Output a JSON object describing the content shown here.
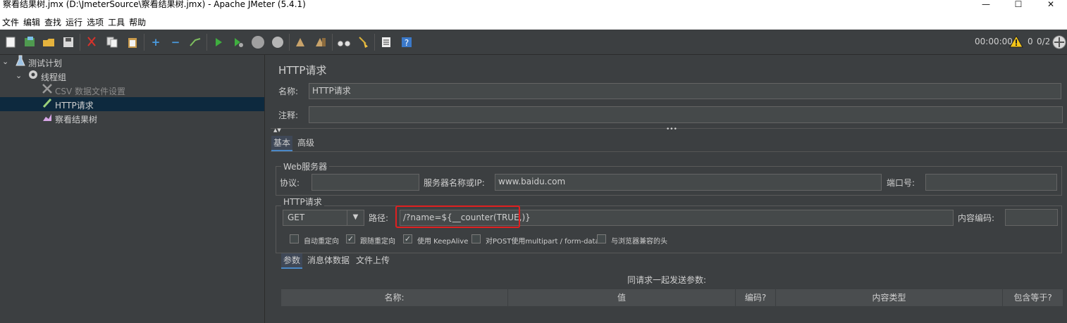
{
  "window": {
    "title": "察看结果树.jmx (D:\\JmeterSource\\察看结果树.jmx) - Apache JMeter (5.4.1)",
    "minimize": "—",
    "maximize": "☐",
    "close": "✕"
  },
  "menu": [
    "文件",
    "编辑",
    "查找",
    "运行",
    "选项",
    "工具",
    "帮助"
  ],
  "toolbar": {
    "timer": "00:00:00",
    "warnings": "0",
    "threads": "0/2"
  },
  "tree": {
    "items": [
      {
        "label": "测试计划"
      },
      {
        "label": "线程组"
      },
      {
        "label": "CSV 数据文件设置"
      },
      {
        "label": "HTTP请求"
      },
      {
        "label": "察看结果树"
      }
    ]
  },
  "panel": {
    "title": "HTTP请求",
    "name_label": "名称:",
    "name_value": "HTTP请求",
    "comment_label": "注释:",
    "comment_value": "",
    "tabs": [
      "基本",
      "高级"
    ],
    "web_server": {
      "legend": "Web服务器",
      "protocol_label": "协议:",
      "protocol_value": "",
      "server_label": "服务器名称或IP:",
      "server_value": "www.baidu.com",
      "port_label": "端口号:",
      "port_value": ""
    },
    "http_request": {
      "legend": "HTTP请求",
      "method": "GET",
      "path_label": "路径:",
      "path_value": "/?name=${__counter(TRUE,)}",
      "encoding_label": "内容编码:",
      "encoding_value": ""
    },
    "options": [
      {
        "label": "自动重定向",
        "checked": false
      },
      {
        "label": "跟随重定向",
        "checked": true
      },
      {
        "label": "使用 KeepAlive",
        "checked": true
      },
      {
        "label": "对POST使用multipart / form-data",
        "checked": false
      },
      {
        "label": "与浏览器兼容的头",
        "checked": false
      }
    ],
    "sub_tabs": [
      "参数",
      "消息体数据",
      "文件上传"
    ],
    "params_caption": "同请求一起发送参数:",
    "table_headers": [
      "名称:",
      "值",
      "编码?",
      "内容类型",
      "包含等于?"
    ]
  },
  "colors": {
    "accent": "#4a88c7",
    "highlight_border": "#e02020",
    "selection": "#0d293e"
  }
}
